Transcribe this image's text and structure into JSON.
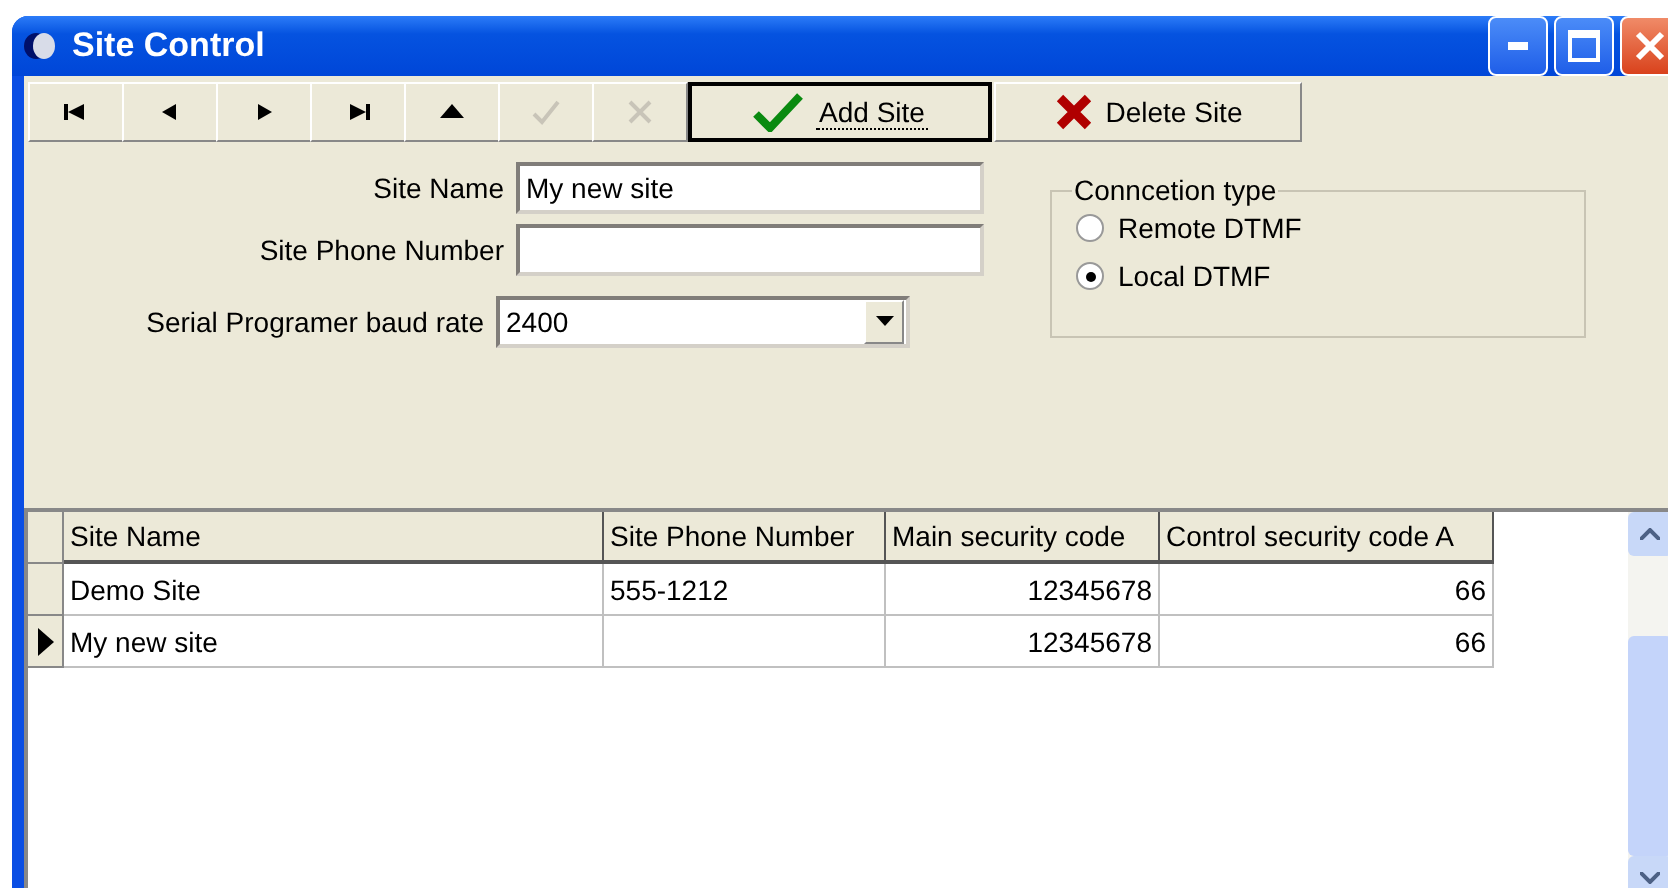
{
  "window": {
    "title": "Site Control"
  },
  "toolbar": {
    "nav_buttons": [
      {
        "kind": "first",
        "disabled": false
      },
      {
        "kind": "prior",
        "disabled": false
      },
      {
        "kind": "next",
        "disabled": false
      },
      {
        "kind": "last",
        "disabled": false
      },
      {
        "kind": "insert",
        "disabled": false
      },
      {
        "kind": "post",
        "disabled": true
      },
      {
        "kind": "cancel",
        "disabled": true
      }
    ],
    "buttons": [
      {
        "kind": "add",
        "label": "Add Site",
        "focused": true
      },
      {
        "kind": "delete",
        "label": "Delete Site",
        "focused": false
      }
    ]
  },
  "form": {
    "site_name": {
      "label": "Site Name",
      "value": "My new site"
    },
    "site_phone": {
      "label": "Site Phone Number"
    },
    "baud_rate": {
      "label": "Serial Programer baud rate",
      "value": "2400"
    }
  },
  "connection_type": {
    "title": "Conncetion type",
    "options": [
      {
        "label": "Remote DTMF",
        "selected": false
      },
      {
        "label": "Local DTMF",
        "selected": true
      }
    ]
  },
  "table": {
    "columns": [
      {
        "label": "Site Name",
        "kind": "text"
      },
      {
        "label": "Site Phone Number",
        "kind": "text"
      },
      {
        "label": "Main security code",
        "kind": "number"
      },
      {
        "label": "Control security code A",
        "kind": "number"
      }
    ],
    "rows": [
      {
        "selected": false,
        "cells": [
          "Demo Site",
          "555-1212",
          "12345678",
          "66"
        ]
      },
      {
        "selected": true,
        "cells": [
          "My new site",
          "",
          "12345678",
          "66"
        ]
      }
    ]
  }
}
